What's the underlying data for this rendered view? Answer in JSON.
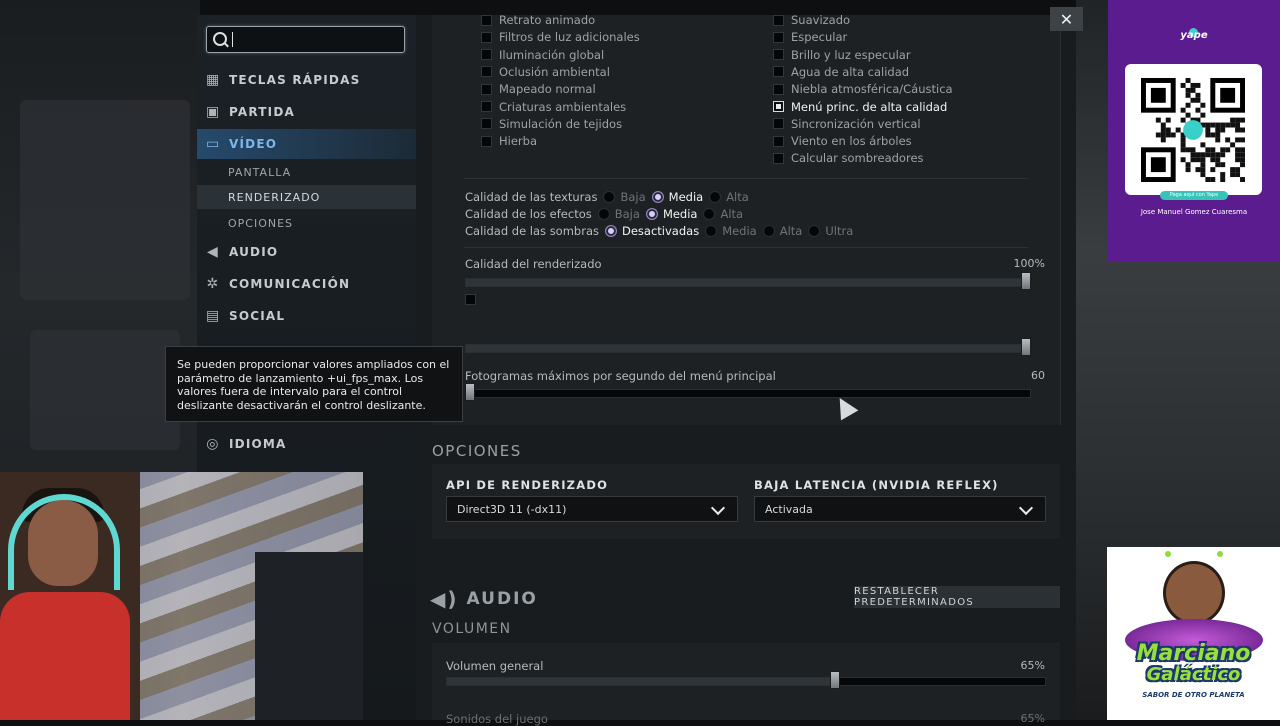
{
  "window": {
    "close_icon": "close-icon"
  },
  "search": {
    "value": "",
    "placeholder": ""
  },
  "sidebar": {
    "items": [
      {
        "label": "TECLAS RÁPIDAS",
        "icon": "keyboard-icon"
      },
      {
        "label": "PARTIDA",
        "icon": "game-icon"
      },
      {
        "label": "VÍDEO",
        "icon": "monitor-icon",
        "active": true
      },
      {
        "label": "AUDIO",
        "icon": "speaker-icon"
      },
      {
        "label": "COMUNICACIÓN",
        "icon": "gear-icon"
      },
      {
        "label": "SOCIAL",
        "icon": "chat-icon"
      },
      {
        "label": "IDIOMA",
        "icon": "globe-icon"
      }
    ],
    "subitems": [
      {
        "label": "PANTALLA"
      },
      {
        "label": "RENDERIZADO",
        "active": true
      },
      {
        "label": "OPCIONES"
      }
    ]
  },
  "tooltip": {
    "text": "Se pueden proporcionar valores ampliados con el parámetro de lanzamiento +ui_fps_max. Los valores fuera de intervalo para el control deslizante desactivarán el control deslizante."
  },
  "video": {
    "left_checks": [
      {
        "label": "Retrato animado",
        "checked": false
      },
      {
        "label": "Filtros de luz adicionales",
        "checked": false
      },
      {
        "label": "Iluminación global",
        "checked": false
      },
      {
        "label": "Oclusión ambiental",
        "checked": false
      },
      {
        "label": "Mapeado normal",
        "checked": false
      },
      {
        "label": "Criaturas ambientales",
        "checked": false
      },
      {
        "label": "Simulación de tejidos",
        "checked": false
      },
      {
        "label": "Hierba",
        "checked": false
      }
    ],
    "right_checks": [
      {
        "label": "Suavizado",
        "checked": false
      },
      {
        "label": "Especular",
        "checked": false
      },
      {
        "label": "Brillo y luz especular",
        "checked": false
      },
      {
        "label": "Agua de alta calidad",
        "checked": false
      },
      {
        "label": "Niebla atmosférica/Cáustica",
        "checked": false
      },
      {
        "label": "Menú princ. de alta calidad",
        "checked": true
      },
      {
        "label": "Sincronización vertical",
        "checked": false
      },
      {
        "label": "Viento en los árboles",
        "checked": false
      },
      {
        "label": "Calcular sombreadores",
        "checked": false
      }
    ],
    "quality_rows": [
      {
        "label": "Calidad de las texturas",
        "options": [
          "Baja",
          "Media",
          "Alta"
        ],
        "selected": "Media"
      },
      {
        "label": "Calidad de los efectos",
        "options": [
          "Baja",
          "Media",
          "Alta"
        ],
        "selected": "Media"
      },
      {
        "label": "Calidad de las sombras",
        "options": [
          "Desactivadas",
          "Media",
          "Alta",
          "Ultra"
        ],
        "selected": "Desactivadas"
      }
    ],
    "render_quality": {
      "label": "Calidad del renderizado",
      "value_text": "100%",
      "level": 1.0
    },
    "hidden_slider": {
      "level": 1.0
    },
    "menu_fps": {
      "label": "Fotogramas máximos por segundo del menú principal",
      "value_text": "60",
      "level": 0.0
    }
  },
  "options": {
    "title": "OPCIONES",
    "render_api": {
      "label": "API DE RENDERIZADO",
      "value": "Direct3D 11 (-dx11)"
    },
    "low_latency": {
      "label": "BAJA LATENCIA (NVIDIA REFLEX)",
      "value": "Activada"
    }
  },
  "audio": {
    "title": "AUDIO",
    "reset_label": "RESTABLECER PREDETERMINADOS",
    "volume_title": "VOLUMEN",
    "general": {
      "label": "Volumen general",
      "value_text": "65%",
      "level": 0.65
    },
    "partial_next": {
      "label": "Sonidos del juego",
      "value_text": "65%"
    }
  },
  "overlay_yape": {
    "brand": "yape",
    "owner": "Jose Manuel Gomez Cuaresma",
    "pay_label": "Paga aquí con Yape"
  },
  "overlay_brand": {
    "line1": "Marciano",
    "line2": "Galáctico",
    "tagline": "SABOR DE OTRO PLANETA"
  },
  "colors": {
    "accent": "#7fb6ea",
    "panel": "#1d2124",
    "yape_purple": "#5b1c8f"
  }
}
